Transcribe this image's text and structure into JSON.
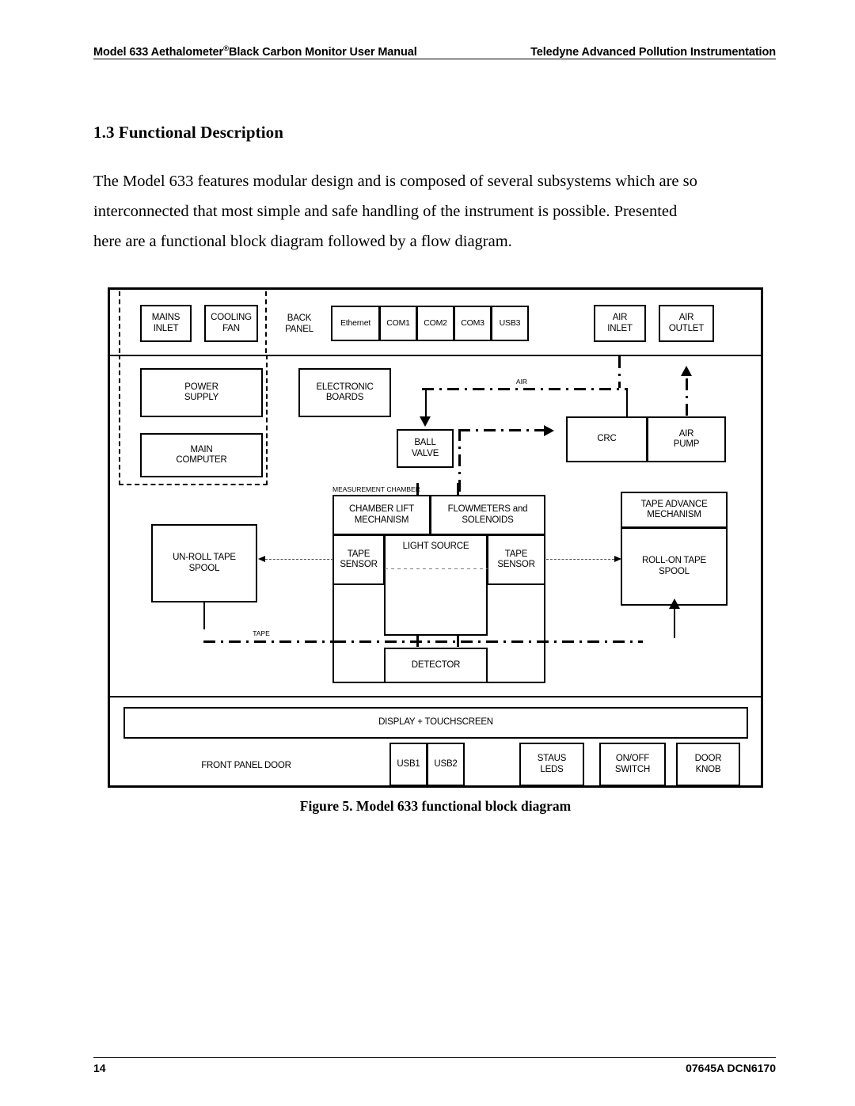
{
  "header": {
    "left_prefix": "Model 633 Aethalometer",
    "left_superscript": "®",
    "left_suffix": "Black Carbon Monitor User Manual",
    "right": "Teledyne Advanced Pollution Instrumentation"
  },
  "section": {
    "title": "1.3 Functional Description",
    "paragraph_line1": "The Model 633 features modular design and is composed of several subsystems which are so",
    "paragraph_line2": "interconnected that most simple and safe handling of the instrument is possible. Presented",
    "paragraph_line3": "here are a functional block diagram followed by a flow diagram."
  },
  "figure": {
    "caption": "Figure 5.  Model 633 functional block diagram",
    "blocks": {
      "mains_inlet": "MAINS\nINLET",
      "cooling_fan": "COOLING\nFAN",
      "back_panel": "BACK\nPANEL",
      "ethernet": "Ethernet",
      "com1": "COM1",
      "com2": "COM2",
      "com3": "COM3",
      "usb3": "USB3",
      "air_inlet": "AIR\nINLET",
      "air_outlet": "AIR\nOUTLET",
      "power_supply": "POWER\nSUPPLY",
      "main_computer": "MAIN\nCOMPUTER",
      "electronic_boards": "ELECTRONIC\nBOARDS",
      "ball_valve": "BALL\nVALVE",
      "crc": "CRC",
      "air_pump": "AIR\nPUMP",
      "measurement_chamber": "MEASUREMENT CHAMBER",
      "chamber_lift_mechanism": "CHAMBER LIFT\nMECHANISM",
      "flowmeters_and_solenoids": "FLOWMETERS and\nSOLENOIDS",
      "tape_sensor_left": "TAPE\nSENSOR",
      "light_source": "LIGHT SOURCE",
      "tape_sensor_right": "TAPE\nSENSOR",
      "detector": "DETECTOR",
      "un_roll_tape_spool": "UN-ROLL TAPE\nSPOOL",
      "tape_advance_mechanism": "TAPE ADVANCE\nMECHANISM",
      "roll_on_tape_spool": "ROLL-ON TAPE\nSPOOL",
      "display_touchscreen": "DISPLAY + TOUCHSCREEN",
      "front_panel_door": "FRONT PANEL DOOR",
      "usb1": "USB1",
      "usb2": "USB2",
      "staus_leds": "STAUS\nLEDS",
      "onoff_switch": "ON/OFF\nSWITCH",
      "door_knob": "DOOR\nKNOB"
    },
    "flow_labels": {
      "air": "AIR",
      "tape": "TAPE"
    }
  },
  "footer": {
    "page_number": "14",
    "document_id": "07645A DCN6170"
  }
}
